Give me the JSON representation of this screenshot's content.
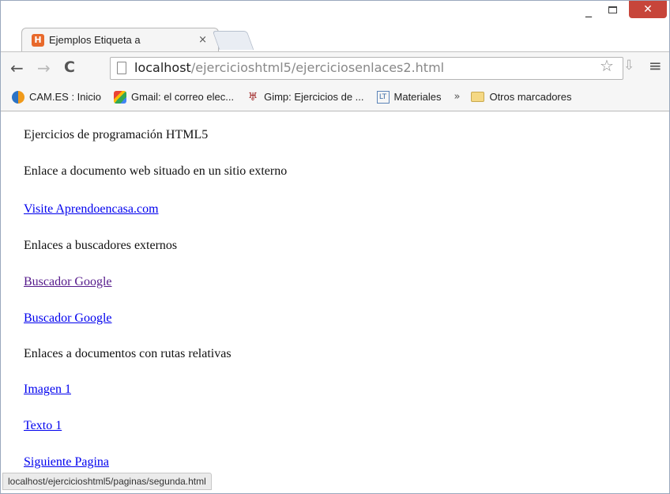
{
  "window": {
    "minimize_glyph": "_",
    "close_glyph": "✕"
  },
  "tab": {
    "title": "Ejemplos Etiqueta a",
    "close_glyph": "×",
    "favicon_glyph": "H"
  },
  "toolbar": {
    "back_glyph": "←",
    "forward_glyph": "→",
    "reload_glyph": "C",
    "url_host": "localhost",
    "url_path": "/ejercicioshtml5/ejerciciosenlaces2.html",
    "star_glyph": "☆",
    "ext_glyph": "⇩",
    "menu_glyph": "≡"
  },
  "bookmarks": {
    "items": [
      {
        "label": "CAM.ES : Inicio",
        "icon": "cam-icon"
      },
      {
        "label": "Gmail: el correo elec...",
        "icon": "gmail-icon"
      },
      {
        "label": "Gimp: Ejercicios de ...",
        "icon": "gimp-icon",
        "glyph": "♅"
      },
      {
        "label": "Materiales",
        "icon": "materiales-icon",
        "glyph": "LT"
      }
    ],
    "more_glyph": "»",
    "other_label": "Otros marcadores"
  },
  "page": {
    "heading": "Ejercicios de programación HTML5",
    "external_intro": "Enlace a documento web situado en un sitio externo",
    "external_link": "Visite Aprendoencasa.com",
    "search_intro": "Enlaces a buscadores externos",
    "google_link_1": "Buscador Google",
    "google_link_2": "Buscador Google",
    "relative_intro": "Enlaces a documentos con rutas relativas",
    "image_link": "Imagen 1",
    "text_link": "Texto 1",
    "next_link": "Siguiente Pagina"
  },
  "status_bar": {
    "text": "localhost/ejercicioshtml5/paginas/segunda.html"
  }
}
